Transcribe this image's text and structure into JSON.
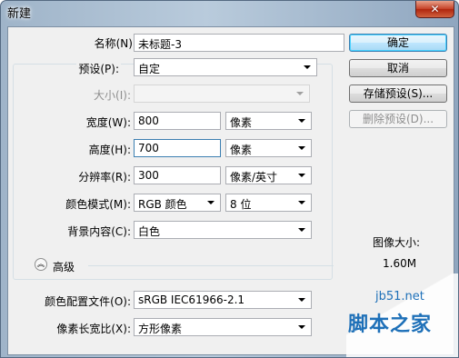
{
  "window": {
    "title": "新建",
    "close_symbol": "✕"
  },
  "fields": {
    "name": {
      "label": "名称(N):",
      "value": "未标题-3"
    },
    "preset": {
      "label": "预设(P):",
      "value": "自定"
    },
    "size": {
      "label": "大小(I):",
      "value": ""
    },
    "width": {
      "label": "宽度(W):",
      "value": "800",
      "unit": "像素"
    },
    "height": {
      "label": "高度(H):",
      "value": "700",
      "unit": "像素"
    },
    "resolution": {
      "label": "分辨率(R):",
      "value": "300",
      "unit": "像素/英寸"
    },
    "color_mode": {
      "label": "颜色模式(M):",
      "value": "RGB 颜色",
      "bits": "8 位"
    },
    "background": {
      "label": "背景内容(C):",
      "value": "白色"
    },
    "advanced": {
      "label": "高级"
    },
    "color_profile": {
      "label": "颜色配置文件(O):",
      "value": "sRGB IEC61966-2.1"
    },
    "pixel_aspect": {
      "label": "像素长宽比(X):",
      "value": "方形像素"
    }
  },
  "buttons": {
    "ok": "确定",
    "cancel": "取消",
    "save_preset": "存储预设(S)...",
    "delete_preset": "删除预设(D)..."
  },
  "image_size": {
    "label": "图像大小:",
    "value": "1.60M"
  },
  "watermark": {
    "url": "jb51.net",
    "name": "脚本之家"
  }
}
